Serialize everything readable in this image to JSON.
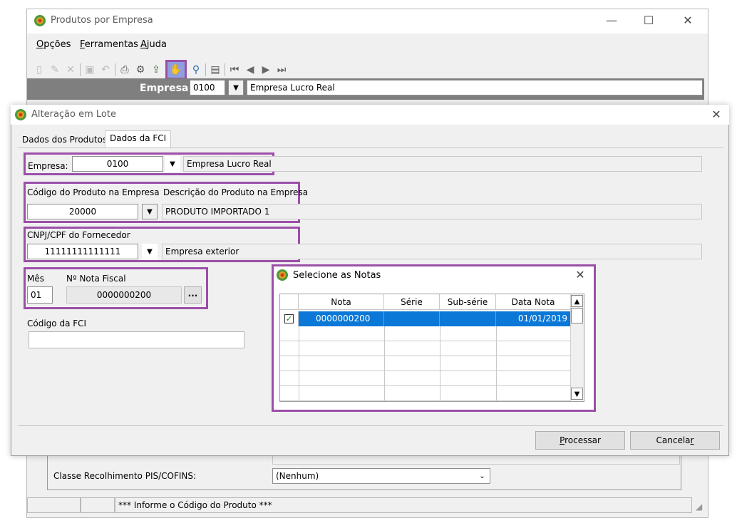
{
  "main_window": {
    "title": "Produtos por Empresa",
    "caption": {
      "minimize": "—",
      "maximize": "☐",
      "close": "✕"
    },
    "menu": [
      {
        "label": "Opções",
        "accel": "O",
        "rest": "pções"
      },
      {
        "label": "Ferramentas",
        "accel": "F",
        "rest": "erramentas"
      },
      {
        "label": "Ajuda",
        "accel": "A",
        "rest": "juda"
      }
    ],
    "toolbar_icons": [
      "new-doc-icon",
      "edit-icon",
      "delete-icon",
      "save-icon",
      "undo-icon",
      "print-icon",
      "print-setup-icon",
      "export-icon",
      "batch-change-icon",
      "search-icon",
      "properties-icon",
      "first-record-icon",
      "prev-record-icon",
      "next-record-icon",
      "last-record-icon"
    ],
    "empresa_bar": {
      "label": "Empresa",
      "code": "0100",
      "name": "Empresa Lucro Real"
    },
    "classe_recolhimento": {
      "label": "Classe Recolhimento PIS/COFINS:",
      "value": "(Nenhum)"
    },
    "status_text": "*** Informe o Código do Produto ***"
  },
  "batch_dialog": {
    "title": "Alteração em Lote",
    "close": "✕",
    "tabs": [
      {
        "label": "Dados dos Produtos",
        "active": false
      },
      {
        "label": "Dados da FCI",
        "active": true
      }
    ],
    "empresa": {
      "label": "Empresa:",
      "code": "0100",
      "name": "Empresa Lucro Real"
    },
    "produto": {
      "code_label": "Código do Produto na Empresa",
      "desc_label": "Descrição do Produto na Empresa",
      "code": "20000",
      "description": "PRODUTO IMPORTADO 1"
    },
    "fornecedor": {
      "label": "CNPJ/CPF do Fornecedor",
      "cnpj": "11111111111111",
      "name": "Empresa exterior"
    },
    "mes": {
      "label": "Mês",
      "value": "01"
    },
    "nota_fiscal": {
      "label": "Nº Nota Fiscal",
      "value": "0000000200",
      "browse": "..."
    },
    "fci": {
      "label": "Código da FCI",
      "value": ""
    },
    "buttons": {
      "processar": {
        "accel": "P",
        "rest": "rocessar"
      },
      "cancelar": {
        "pre": "Cancela",
        "accel": "r"
      }
    }
  },
  "notes_dialog": {
    "title": "Selecione as Notas",
    "close": "✕",
    "columns": [
      "Nota",
      "Série",
      "Sub-série",
      "Data Nota"
    ],
    "rows": [
      {
        "checked": true,
        "nota": "0000000200",
        "serie": "",
        "subserie": "",
        "data": "01/01/2019"
      }
    ],
    "scroll_up": "▲",
    "scroll_down": "▼"
  },
  "colors": {
    "highlight": "#9b4fa8",
    "selection": "#0b78d7",
    "empresa_bar": "#7f7f7f"
  }
}
